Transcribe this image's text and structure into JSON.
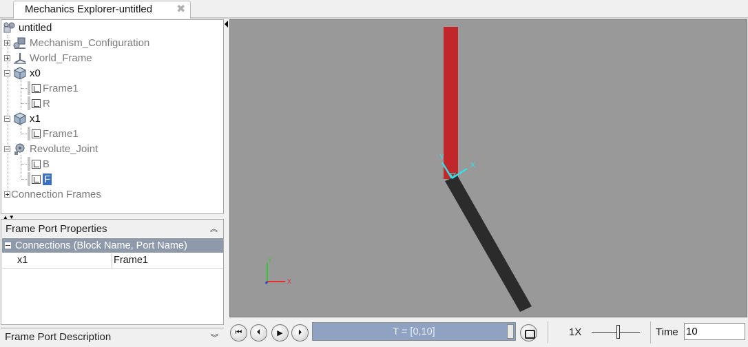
{
  "tab": {
    "title": "Mechanics Explorer-untitled",
    "close": "✖"
  },
  "tree": {
    "root": "untitled",
    "mechanism_configuration": "Mechanism_Configuration",
    "world_frame": "World_Frame",
    "x0": {
      "label": "x0",
      "frame1": "Frame1",
      "r": "R"
    },
    "x1": {
      "label": "x1",
      "frame1": "Frame1"
    },
    "revolute_joint": {
      "label": "Revolute_Joint",
      "b": "B",
      "f": "F"
    },
    "connection_frames": "Connection Frames"
  },
  "properties": {
    "header": "Frame Port Properties",
    "group": "Connections (Block Name, Port Name)",
    "row": {
      "block": "x1",
      "port": "Frame1"
    }
  },
  "description": {
    "header": "Frame Port Description"
  },
  "viewport": {
    "joint_axis_labels": {
      "x": "X",
      "y": "Y"
    },
    "world_axis_labels": {
      "x": "X",
      "y": "Y"
    },
    "colors": {
      "background": "#999999",
      "red_body": "#c0272a",
      "black_body": "#2b2b2b",
      "axis_cyan": "#33e0e6"
    }
  },
  "controls": {
    "timeline_label": "T = [0,10]",
    "speed": "1X",
    "time_label": "Time",
    "time_value": "10"
  }
}
